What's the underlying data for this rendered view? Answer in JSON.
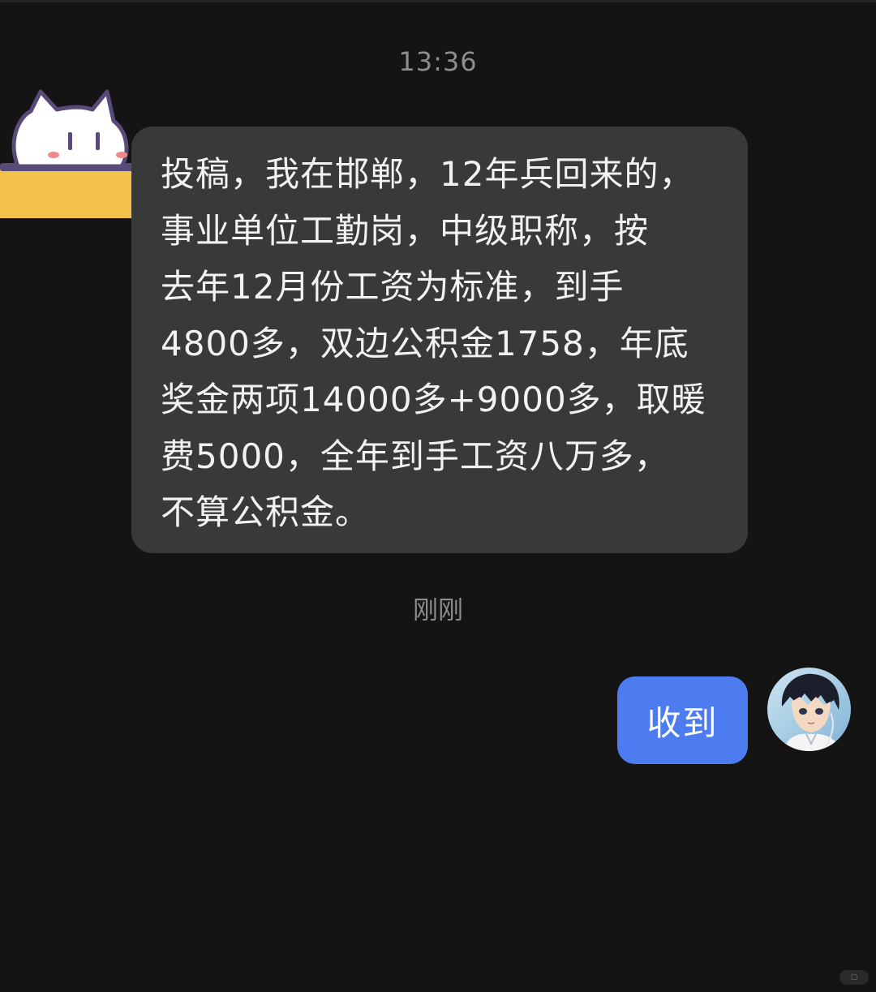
{
  "chat": {
    "time_top": "13:36",
    "time_mid": "刚刚",
    "incoming_message": "投稿，我在邯郸，12年兵回来的，\n事业单位工勤岗，中级职称，按\n去年12月份工资为标准，到手\n4800多，双边公积金1758，年底\n奖金两项14000多+9000多，取暖\n费5000，全年到手工资八万多，\n不算公积金。",
    "outgoing_message": "收到"
  },
  "icons": {
    "sender_sticker": "white-cat-sticker-icon",
    "user_avatar": "anime-character-avatar-icon"
  },
  "colors": {
    "background": "#141414",
    "incoming_bubble": "#393939",
    "outgoing_bubble": "#4d7cf0",
    "timestamp": "#8d8d8d"
  }
}
